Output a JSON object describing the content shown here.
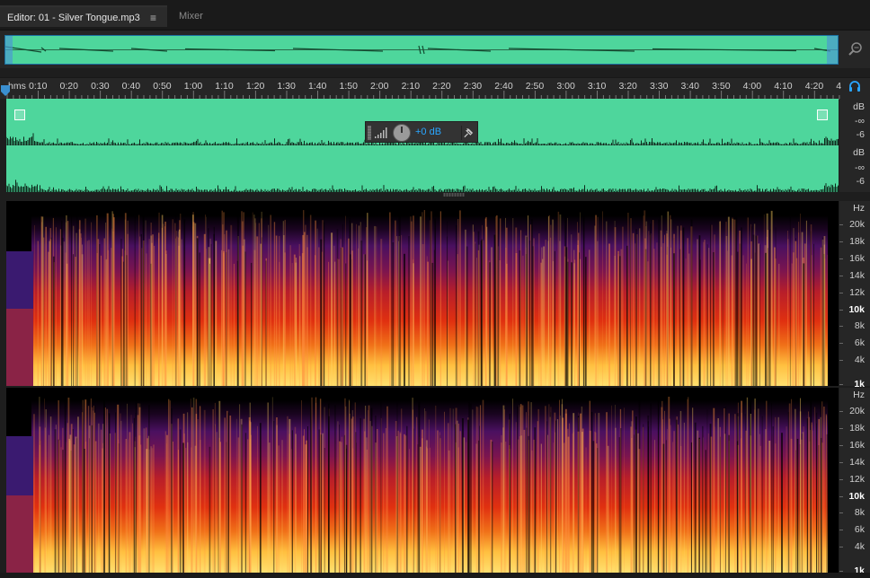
{
  "tabs": {
    "editor_label": "Editor: 01 - Silver Tongue.mp3",
    "mixer_label": "Mixer"
  },
  "timeline": {
    "format_label": "hms",
    "ticks": [
      "0:10",
      "0:20",
      "0:30",
      "0:40",
      "0:50",
      "1:00",
      "1:10",
      "1:20",
      "1:30",
      "1:40",
      "1:50",
      "2:00",
      "2:10",
      "2:20",
      "2:30",
      "2:40",
      "2:50",
      "3:00",
      "3:10",
      "3:20",
      "3:30",
      "3:40",
      "3:50",
      "4:00",
      "4:10",
      "4:20",
      "4"
    ]
  },
  "hud": {
    "volume_value": "+0 dB"
  },
  "amplitude_ruler": {
    "ch1": {
      "unit": "dB",
      "inf": "-∞",
      "minus6": "-6"
    },
    "ch2": {
      "unit": "dB",
      "inf": "-∞",
      "minus6": "-6"
    }
  },
  "frequency_ruler": {
    "unit": "Hz",
    "labels": [
      "20k",
      "18k",
      "16k",
      "14k",
      "12k",
      "10k",
      "8k",
      "6k",
      "4k",
      "1k"
    ]
  },
  "colors": {
    "waveform_bg": "#4ed69c",
    "accent_blue": "#2aa6ff",
    "spectral_low": "#ffe070",
    "spectral_mid": "#e03010",
    "spectral_high": "#4a1060"
  },
  "icons": {
    "tab_menu": "hamburger-menu-icon",
    "zoom": "zoom-magnifier-icon",
    "monitor": "headphone-icon",
    "pin": "pin-icon",
    "playhead": "playhead-marker-icon"
  }
}
